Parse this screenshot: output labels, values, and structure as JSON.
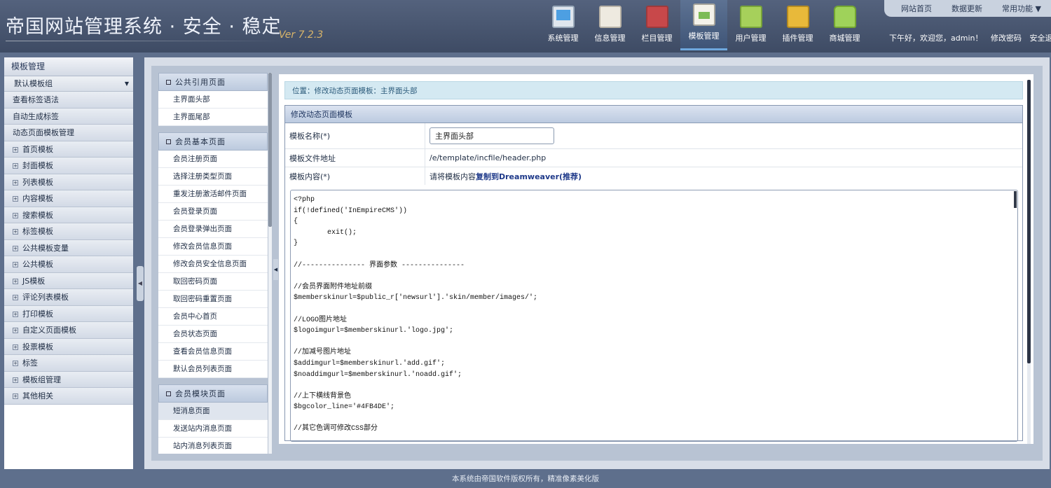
{
  "header": {
    "logo_text": "帝国网站管理系统 · 安全 · 稳定",
    "version": "Ver 7.2.3",
    "nav": [
      {
        "label": "系统管理",
        "icon": "monitor-icon"
      },
      {
        "label": "信息管理",
        "icon": "notepad-icon"
      },
      {
        "label": "栏目管理",
        "icon": "book-icon"
      },
      {
        "label": "模板管理",
        "icon": "document-icon",
        "active": true
      },
      {
        "label": "用户管理",
        "icon": "cabinet-icon"
      },
      {
        "label": "插件管理",
        "icon": "box-icon"
      },
      {
        "label": "商城管理",
        "icon": "shopping-bag-icon"
      }
    ],
    "top_links": [
      "网站首页",
      "数据更新",
      "常用功能 ▼"
    ],
    "greeting": "下午好，欢迎您，admin！",
    "change_password": "修改密码",
    "logout": "安全退出"
  },
  "sidebar": {
    "title": "模板管理",
    "select_value": "默认模板组",
    "plain_items": [
      "查看标签语法",
      "自动生成标签",
      "动态页面模板管理"
    ],
    "tree_items": [
      "首页模板",
      "封面模板",
      "列表模板",
      "内容模板",
      "搜索模板",
      "标签模板",
      "公共模板变量",
      "公共模板",
      "JS模板",
      "评论列表模板",
      "打印模板",
      "自定义页面模板",
      "投票模板",
      "标签",
      "模板组管理",
      "其他相关"
    ]
  },
  "mid": {
    "groups": [
      {
        "title": "公共引用页面",
        "items": [
          "主界面头部",
          "主界面尾部"
        ]
      },
      {
        "title": "会员基本页面",
        "items": [
          "会员注册页面",
          "选择注册类型页面",
          "重发注册激活邮件页面",
          "会员登录页面",
          "会员登录弹出页面",
          "修改会员信息页面",
          "修改会员安全信息页面",
          "取回密码页面",
          "取回密码重置页面",
          "会员中心首页",
          "会员状态页面",
          "查看会员信息页面",
          "默认会员列表页面"
        ]
      },
      {
        "title": "会员模块页面",
        "items": [
          "短消息页面",
          "发送站内消息页面",
          "站内消息列表页面"
        ]
      }
    ]
  },
  "content": {
    "breadcrumb": "位置：修改动态页面模板：主界面头部",
    "form_title": "修改动态页面模板",
    "name_label": "模板名称(*)",
    "name_value": "主界面头部",
    "file_label": "模板文件地址",
    "file_value": "/e/template/incfile/header.php",
    "content_label": "模板内容(*)",
    "copy_hint": "请将模板内容",
    "copy_link": "复制到Dreamweaver(推荐)",
    "code": "<?php\nif(!defined('InEmpireCMS'))\n{\n        exit();\n}\n\n//--------------- 界面参数 ---------------\n\n//会员界面附件地址前缀\n$memberskinurl=$public_r['newsurl'].'skin/member/images/';\n\n//LOGO图片地址\n$logoimgurl=$memberskinurl.'logo.jpg';\n\n//加减号图片地址\n$addimgurl=$memberskinurl.'add.gif';\n$noaddimgurl=$memberskinurl.'noadd.gif';\n\n//上下横线背景色\n$bgcolor_line='#4FB4DE';\n\n//其它色调可修改CSS部分"
  },
  "footer": "本系统由帝国软件版权所有，精准像素美化版"
}
